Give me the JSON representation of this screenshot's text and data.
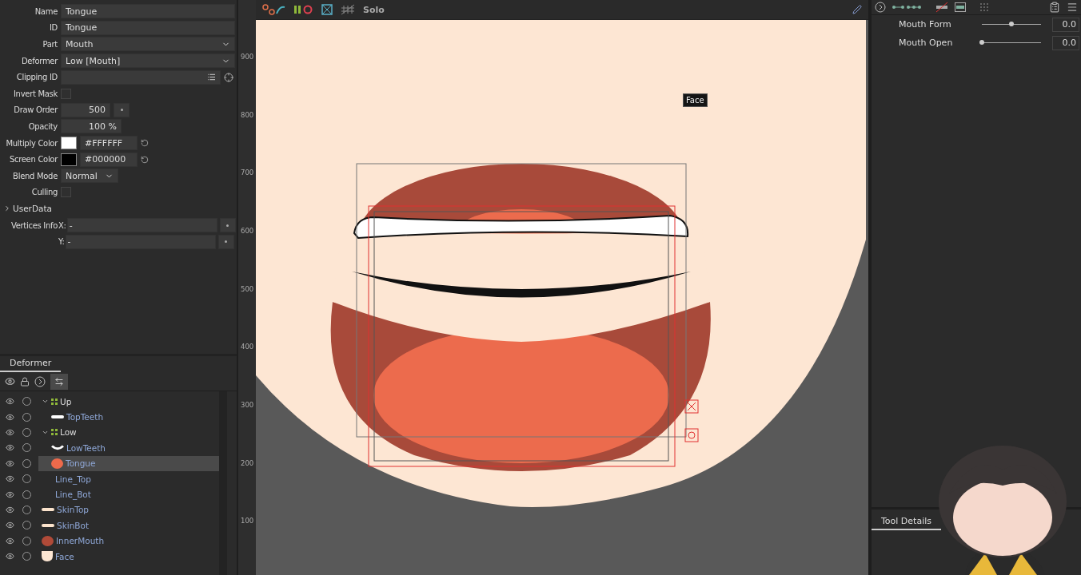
{
  "properties": [
    {
      "kind": "text",
      "label": "Name",
      "value": "Tongue"
    },
    {
      "kind": "text",
      "label": "ID",
      "value": "Tongue"
    },
    {
      "kind": "select",
      "label": "Part",
      "value": "Mouth"
    },
    {
      "kind": "select",
      "label": "Deformer",
      "value": "Low  [Mouth]"
    },
    {
      "kind": "clip",
      "label": "Clipping ID"
    },
    {
      "kind": "check",
      "label": "Invert Mask",
      "checked": false
    },
    {
      "kind": "number",
      "label": "Draw Order",
      "value": "500"
    },
    {
      "kind": "percent",
      "label": "Opacity",
      "value": "100",
      "unit": "%"
    },
    {
      "kind": "color",
      "label": "Multiply Color",
      "value": "#FFFFFF",
      "color": "#ffffff"
    },
    {
      "kind": "color",
      "label": "Screen Color",
      "value": "#000000",
      "color": "#000000"
    },
    {
      "kind": "blend",
      "label": "Blend Mode",
      "value": "Normal"
    },
    {
      "kind": "check",
      "label": "Culling",
      "checked": false
    },
    {
      "kind": "group",
      "label": "UserData",
      "expanded": false
    },
    {
      "kind": "coord",
      "label": "Vertices Info",
      "axis": "X:",
      "value": "-"
    },
    {
      "kind": "coord",
      "axis": "Y:",
      "value": "-"
    }
  ],
  "deformer_panel": {
    "tabs": [
      {
        "label": "Deformer",
        "selected": true
      }
    ],
    "tree": [
      {
        "kind": "deformer",
        "label": "Up",
        "expanded": true,
        "selected": false,
        "children": [
          {
            "kind": "mesh",
            "label": "TopTeeth",
            "thumb": {
              "kind": "bar",
              "color": "#ffffff"
            },
            "selected": false
          }
        ]
      },
      {
        "kind": "deformer",
        "label": "Low",
        "expanded": true,
        "selected": false,
        "children": [
          {
            "kind": "mesh",
            "label": "LowTeeth",
            "thumb": {
              "kind": "curve",
              "color": "#ffffff"
            },
            "selected": false
          },
          {
            "kind": "mesh",
            "label": "Tongue",
            "thumb": {
              "kind": "dot",
              "color": "#ee6a4b"
            },
            "selected": true
          }
        ]
      },
      {
        "kind": "mesh",
        "label": "Line_Top",
        "selected": false
      },
      {
        "kind": "mesh",
        "label": "Line_Bot",
        "selected": false
      },
      {
        "kind": "mesh",
        "label": "SkinTop",
        "thumb": {
          "kind": "bar",
          "color": "#fbe3cc"
        },
        "selected": false
      },
      {
        "kind": "mesh",
        "label": "SkinBot",
        "thumb": {
          "kind": "bar",
          "color": "#fbe3cc"
        },
        "selected": false
      },
      {
        "kind": "mesh",
        "label": "InnerMouth",
        "thumb": {
          "kind": "dot",
          "color": "#b04a38"
        },
        "selected": false
      },
      {
        "kind": "mesh",
        "label": "Face",
        "thumb": {
          "kind": "face",
          "color": "#fde6d3"
        },
        "selected": false
      }
    ]
  },
  "ruler": [
    "900",
    "800",
    "700",
    "600",
    "500",
    "400",
    "300",
    "200",
    "100"
  ],
  "canvas_toolbar": {
    "solo": "Solo"
  },
  "tooltip": "Face",
  "parameters": [
    {
      "name": "Mouth Form",
      "value": "0.0",
      "level": 0.5
    },
    {
      "name": "Mouth Open",
      "value": "0.0",
      "level": 0.0
    }
  ],
  "tool_details": {
    "tabs": [
      {
        "label": "Tool Details",
        "selected": true
      }
    ]
  }
}
